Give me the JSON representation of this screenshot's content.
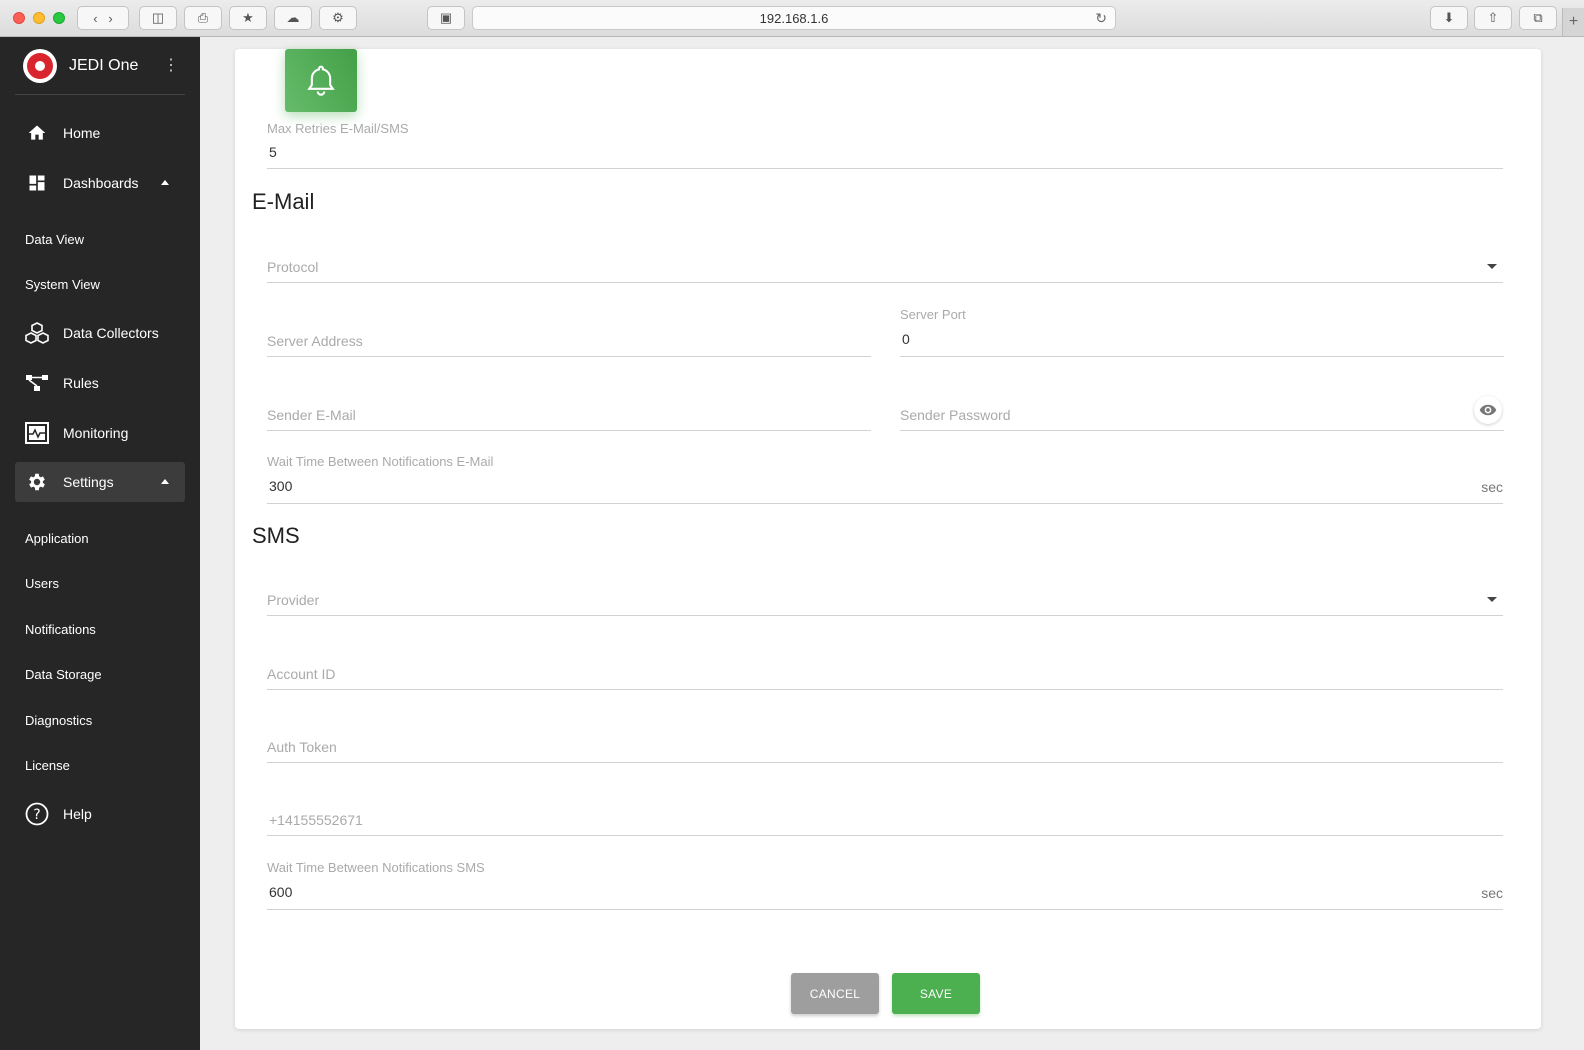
{
  "browser": {
    "url": "192.168.1.6"
  },
  "sidebar": {
    "brand": "JEDI One",
    "items": [
      {
        "label": "Home",
        "icon": "home-icon"
      },
      {
        "label": "Dashboards",
        "icon": "dashboard-icon"
      },
      {
        "label": "Data View"
      },
      {
        "label": "System View"
      },
      {
        "label": "Data Collectors",
        "icon": "cubes-icon"
      },
      {
        "label": "Rules",
        "icon": "flow-icon"
      },
      {
        "label": "Monitoring",
        "icon": "monitor-icon"
      },
      {
        "label": "Settings",
        "icon": "gear-icon"
      },
      {
        "label": "Application"
      },
      {
        "label": "Users"
      },
      {
        "label": "Notifications"
      },
      {
        "label": "Data Storage"
      },
      {
        "label": "Diagnostics"
      },
      {
        "label": "License"
      },
      {
        "label": "Help",
        "icon": "help-icon"
      }
    ]
  },
  "form": {
    "max_retries": {
      "label": "Max Retries E-Mail/SMS",
      "value": "5"
    },
    "email_title": "E-Mail",
    "protocol": {
      "label": "Protocol"
    },
    "server_address": {
      "label": "Server Address"
    },
    "server_port": {
      "label": "Server Port",
      "value": "0"
    },
    "sender_email": {
      "label": "Sender E-Mail"
    },
    "sender_password": {
      "label": "Sender Password"
    },
    "wait_email": {
      "label": "Wait Time Between Notifications E-Mail",
      "value": "300",
      "suffix": "sec"
    },
    "sms_title": "SMS",
    "provider": {
      "label": "Provider"
    },
    "account_id": {
      "label": "Account ID"
    },
    "auth_token": {
      "label": "Auth Token"
    },
    "phone": {
      "placeholder": "+14155552671"
    },
    "wait_sms": {
      "label": "Wait Time Between Notifications SMS",
      "value": "600",
      "suffix": "sec"
    }
  },
  "actions": {
    "cancel": "CANCEL",
    "save": "SAVE"
  },
  "colors": {
    "accent": "#4caf50",
    "sidebar": "#262626",
    "brand_red": "#d9262e"
  }
}
